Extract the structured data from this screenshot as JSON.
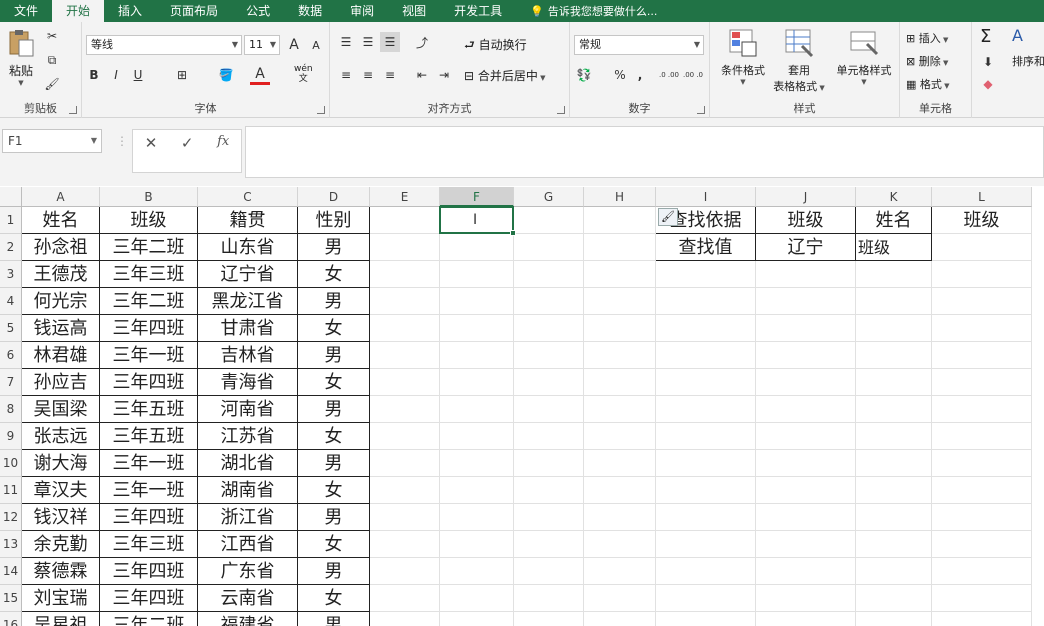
{
  "tabs": [
    "文件",
    "开始",
    "插入",
    "页面布局",
    "公式",
    "数据",
    "审阅",
    "视图",
    "开发工具"
  ],
  "tell_me": "告诉我您想要做什么...",
  "ribbon": {
    "clipboard": {
      "paste": "粘贴",
      "label": "剪贴板"
    },
    "font": {
      "name": "等线",
      "size": "11",
      "grow": "A",
      "shrink": "A",
      "bold": "B",
      "italic": "I",
      "underline": "U",
      "color_letter": "A",
      "phonetic": "wén",
      "phonetic2": "文",
      "label": "字体"
    },
    "alignment": {
      "wrap": "自动换行",
      "merge": "合并后居中",
      "label": "对齐方式"
    },
    "number": {
      "format": "常规",
      "percent": "%",
      "comma": ",",
      "inc": ".0 .00",
      "dec": ".00 .0",
      "label": "数字"
    },
    "styles": {
      "conditional": "条件格式",
      "table1": "套用",
      "table2": "表格格式",
      "cell": "单元格样式",
      "label": "样式"
    },
    "cells": {
      "insert": "插入",
      "delete": "删除",
      "format": "格式",
      "label": "单元格"
    },
    "editing": {
      "sigma": "Σ",
      "sort": "排序和"
    }
  },
  "formula_bar": {
    "name_box": "F1",
    "cancel": "✕",
    "enter": "✓",
    "fx": "fx",
    "value": ""
  },
  "accent": "#217346",
  "columns": [
    "A",
    "B",
    "C",
    "D",
    "E",
    "F",
    "G",
    "H",
    "I",
    "J",
    "K",
    "L"
  ],
  "selected_column": "F",
  "rows": [
    [
      "姓名",
      "班级",
      "籍贯",
      "性别",
      "",
      "",
      "",
      "",
      "查找依据",
      "班级",
      "姓名",
      "班级"
    ],
    [
      "孙念祖",
      "三年二班",
      "山东省",
      "男",
      "",
      "",
      "",
      "",
      "查找值",
      "辽宁",
      "班级",
      ""
    ],
    [
      "王德茂",
      "三年三班",
      "辽宁省",
      "女",
      "",
      "",
      "",
      "",
      "",
      "",
      "",
      ""
    ],
    [
      "何光宗",
      "三年二班",
      "黑龙江省",
      "男",
      "",
      "",
      "",
      "",
      "",
      "",
      "",
      ""
    ],
    [
      "钱运高",
      "三年四班",
      "甘肃省",
      "女",
      "",
      "",
      "",
      "",
      "",
      "",
      "",
      ""
    ],
    [
      "林君雄",
      "三年一班",
      "吉林省",
      "男",
      "",
      "",
      "",
      "",
      "",
      "",
      "",
      ""
    ],
    [
      "孙应吉",
      "三年四班",
      "青海省",
      "女",
      "",
      "",
      "",
      "",
      "",
      "",
      "",
      ""
    ],
    [
      "吴国梁",
      "三年五班",
      "河南省",
      "男",
      "",
      "",
      "",
      "",
      "",
      "",
      "",
      ""
    ],
    [
      "张志远",
      "三年五班",
      "江苏省",
      "女",
      "",
      "",
      "",
      "",
      "",
      "",
      "",
      ""
    ],
    [
      "谢大海",
      "三年一班",
      "湖北省",
      "男",
      "",
      "",
      "",
      "",
      "",
      "",
      "",
      ""
    ],
    [
      "章汉夫",
      "三年一班",
      "湖南省",
      "女",
      "",
      "",
      "",
      "",
      "",
      "",
      "",
      ""
    ],
    [
      "钱汉祥",
      "三年四班",
      "浙江省",
      "男",
      "",
      "",
      "",
      "",
      "",
      "",
      "",
      ""
    ],
    [
      "余克勤",
      "三年三班",
      "江西省",
      "女",
      "",
      "",
      "",
      "",
      "",
      "",
      "",
      ""
    ],
    [
      "蔡德霖",
      "三年四班",
      "广东省",
      "男",
      "",
      "",
      "",
      "",
      "",
      "",
      "",
      ""
    ],
    [
      "刘宝瑞",
      "三年四班",
      "云南省",
      "女",
      "",
      "",
      "",
      "",
      "",
      "",
      "",
      ""
    ],
    [
      "吴星祖",
      "三年二班",
      "福建省",
      "男",
      "",
      "",
      "",
      "",
      "",
      "",
      "",
      ""
    ]
  ],
  "row_numbers": [
    "1",
    "2",
    "3",
    "4",
    "5",
    "6",
    "7",
    "8",
    "9",
    "10",
    "11",
    "12",
    "13",
    "14",
    "15",
    "16"
  ]
}
